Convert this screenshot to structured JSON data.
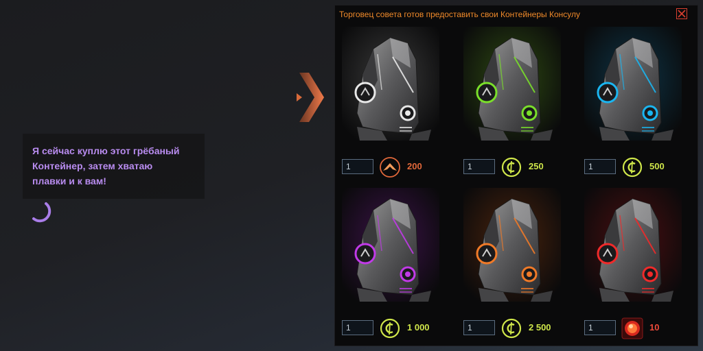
{
  "speech": {
    "lines": [
      "Я сейчас куплю этот грёбаный",
      "Контейнер, затем хватаю",
      "плавки и к вам!"
    ]
  },
  "panel": {
    "title": "Торговец совета готов предоставить свои Контейнеры Консулу"
  },
  "containers": [
    {
      "quantity": "1",
      "price": "200",
      "currency": "rank-chevron-icon",
      "glow": "#e8e8e8",
      "bg": "#3a3a3a",
      "price_color": "#e2683a"
    },
    {
      "quantity": "1",
      "price": "250",
      "currency": "credits-icon",
      "glow": "#7adf2a",
      "bg": "#2e4a12",
      "price_color": "#cfe64a"
    },
    {
      "quantity": "1",
      "price": "500",
      "currency": "credits-icon",
      "glow": "#1ab5f0",
      "bg": "#0d3446",
      "price_color": "#cfe64a"
    },
    {
      "quantity": "1",
      "price": "1 000",
      "currency": "credits-icon",
      "glow": "#c13ae8",
      "bg": "#3b1248",
      "price_color": "#cfe64a"
    },
    {
      "quantity": "1",
      "price": "2 500",
      "currency": "credits-icon",
      "glow": "#f07a28",
      "bg": "#4a230d",
      "price_color": "#cfe64a"
    },
    {
      "quantity": "1",
      "price": "10",
      "currency": "red-crystal-icon",
      "glow": "#f02a2a",
      "bg": "#4a0e10",
      "price_color": "#ee4a3a"
    }
  ]
}
